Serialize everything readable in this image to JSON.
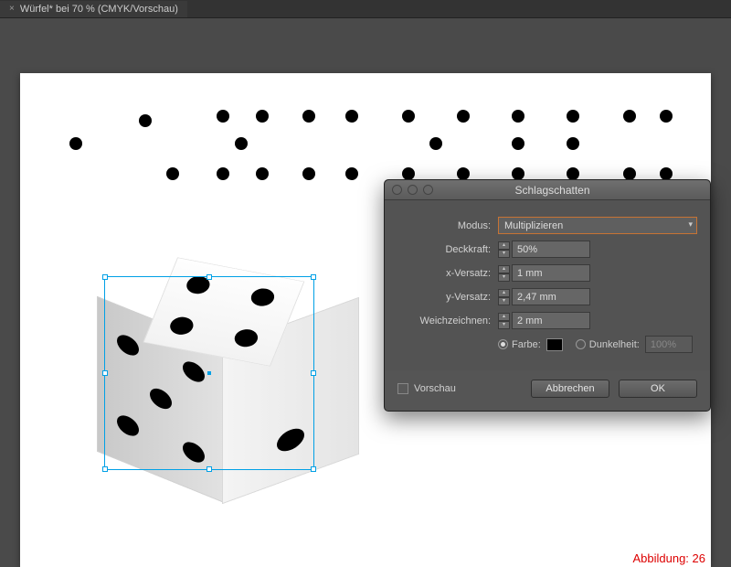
{
  "tab": {
    "close": "×",
    "title": "Würfel* bei 70 % (CMYK/Vorschau)"
  },
  "dialog": {
    "title": "Schlagschatten",
    "modus_label": "Modus:",
    "modus_value": "Multiplizieren",
    "deckkraft_label": "Deckkraft:",
    "deckkraft_value": "50%",
    "x_label": "x-Versatz:",
    "x_value": "1 mm",
    "y_label": "y-Versatz:",
    "y_value": "2,47 mm",
    "blur_label": "Weichzeichnen:",
    "blur_value": "2 mm",
    "farbe_label": "Farbe:",
    "dunkel_label": "Dunkelheit:",
    "dunkel_value": "100%",
    "vorschau_label": "Vorschau",
    "cancel": "Abbrechen",
    "ok": "OK"
  },
  "caption": "Abbildung: 26"
}
